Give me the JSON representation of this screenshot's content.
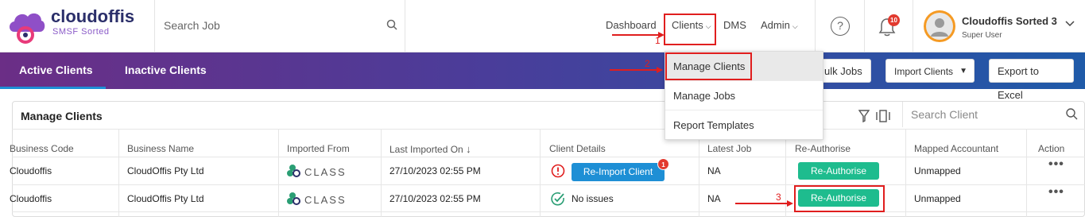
{
  "app": {
    "brand": "cloudoffis",
    "brand_sub": "SMSF Sorted"
  },
  "header": {
    "search_placeholder": "Search Job",
    "nav": [
      "Dashboard",
      "Clients",
      "DMS",
      "Admin"
    ],
    "notification_count": "10",
    "user_name": "Cloudoffis Sorted 3",
    "user_role": "Super User"
  },
  "tabs": [
    "Active Clients",
    "Inactive Clients"
  ],
  "toolbar": {
    "bulk_jobs": "ulk Jobs",
    "import_clients": "Import Clients",
    "export": "Export to Excel"
  },
  "dropdown": {
    "items": [
      "Manage Clients",
      "Manage Jobs",
      "Report Templates"
    ]
  },
  "panel": {
    "title": "Manage Clients",
    "search_placeholder": "Search Client"
  },
  "table": {
    "columns": [
      "Business Code",
      "Business Name",
      "Imported From",
      "Last Imported On",
      "Client Details",
      "Latest Job",
      "Re-Authorise",
      "Mapped Accountant",
      "Action"
    ],
    "rows": [
      {
        "code": "Cloudoffis",
        "name": "CloudOffis Pty Ltd",
        "imported_from": "CLASS",
        "last_imported": "27/10/2023 02:55 PM",
        "details": "Re-Import Client",
        "details_badge": "1",
        "latest_job": "NA",
        "reauth": "Re-Authorise",
        "accountant": "Unmapped"
      },
      {
        "code": "Cloudoffis",
        "name": "CloudOffis Pty Ltd",
        "imported_from": "CLASS",
        "last_imported": "27/10/2023 02:55 PM",
        "details": "No issues",
        "latest_job": "NA",
        "reauth": "Re-Authorise",
        "accountant": "Unmapped"
      }
    ]
  },
  "annotations": [
    "1",
    "2",
    "3"
  ],
  "colors": {
    "accent": "#1e8fd5",
    "green": "#1ebc8e",
    "red": "#e01e1e"
  }
}
